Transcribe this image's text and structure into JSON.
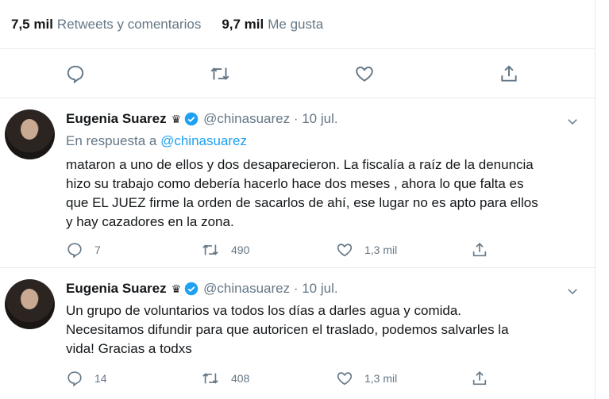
{
  "stats": {
    "retweets_count": "7,5 mil",
    "retweets_label": "Retweets y comentarios",
    "likes_count": "9,7 mil",
    "likes_label": "Me gusta"
  },
  "tweets": [
    {
      "name": "Eugenia Suarez",
      "badge_icon": "crown-icon",
      "handle_date": "@chinasuarez · 10 jul.",
      "reply_prefix": "En respuesta a ",
      "reply_mention": "@chinasuarez",
      "lines": [
        "mataron a uno de ellos y dos desaparecieron. La fiscalía a raíz de la denuncia",
        "hizo su trabajo como debería hacerlo hace dos meses , ahora lo que falta es",
        "que EL JUEZ firme la orden de sacarlos de ahí, ese lugar no es apto para ellos",
        "y hay cazadores en la zona."
      ],
      "replies": "7",
      "retweets": "490",
      "likes": "1,3 mil"
    },
    {
      "name": "Eugenia Suarez",
      "badge_icon": "crown-icon",
      "handle_date": "@chinasuarez · 10 jul.",
      "lines": [
        "Un grupo de voluntarios va todos los días a darles agua y comida.",
        "Necesitamos difundir para que autoricen el traslado, podemos salvarles la",
        "vida! Gracias a todxs"
      ],
      "replies": "14",
      "retweets": "408",
      "likes": "1,3 mil"
    }
  ],
  "colors": {
    "accent": "#1da1f2",
    "muted": "#657786",
    "text": "#14171a",
    "border": "#e6ecf0"
  }
}
